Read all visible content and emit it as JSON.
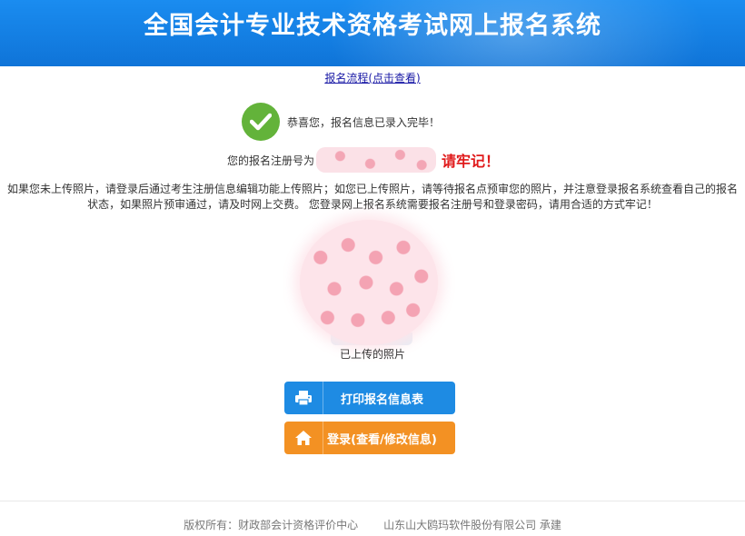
{
  "header": {
    "title": "全国会计专业技术资格考试网上报名系统"
  },
  "flow_link": "报名流程(点击查看)",
  "success": {
    "message": "恭喜您，报名信息已录入完毕！",
    "icon": "check-icon",
    "color": "#63b33a"
  },
  "registration": {
    "label": "您的报名注册号为",
    "warning": "请牢记！"
  },
  "notice": "如果您未上传照片，请登录后通过考生注册信息编辑功能上传照片；如您已上传照片，请等待报名点预审您的照片，并注意登录报名系统查看自己的报名状态，如果照片预审通过，请及时网上交费。 您登录网上报名系统需要报名注册号和登录密码，请用合适的方式牢记！",
  "photo": {
    "caption": "已上传的照片"
  },
  "buttons": {
    "print": {
      "label": "打印报名信息表",
      "icon": "printer-icon",
      "color": "#1e8be3"
    },
    "login": {
      "label": "登录(查看/修改信息)",
      "icon": "home-icon",
      "color": "#f39123"
    }
  },
  "footer": {
    "copyright": "版权所有：财政部会计资格评价中心",
    "vendor": "山东山大鸥玛软件股份有限公司 承建"
  }
}
